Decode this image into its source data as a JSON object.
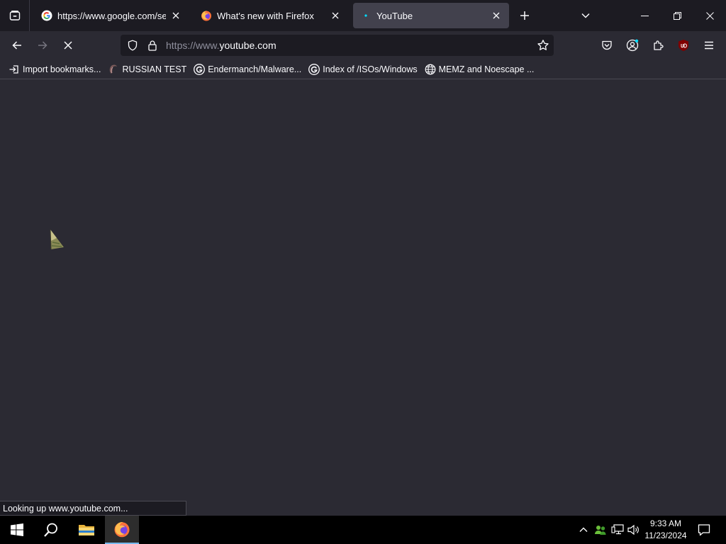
{
  "tabs": [
    {
      "title": "https://www.google.com/search?q=",
      "icon": "google-g-icon",
      "active": false
    },
    {
      "title": "What's new with Firefox",
      "icon": "firefox-icon",
      "active": false
    },
    {
      "title": "YouTube",
      "icon": "loading-dot-icon",
      "active": true
    }
  ],
  "urlbar": {
    "prefix": "https://www.",
    "domain": "youtube.com"
  },
  "bookmarks": [
    {
      "label": "Import bookmarks...",
      "icon": "import-icon"
    },
    {
      "label": "RUSSIAN TEST",
      "icon": "cursor-icon"
    },
    {
      "label": "Endermanch/Malware...",
      "icon": "google-g-icon"
    },
    {
      "label": "Index of /ISOs/Windows",
      "icon": "google-g-icon"
    },
    {
      "label": "MEMZ and Noescape ...",
      "icon": "globe-icon"
    }
  ],
  "status_text": "Looking up www.youtube.com...",
  "clock": {
    "time": "9:33 AM",
    "date": "11/23/2024"
  },
  "colors": {
    "toolbar": "#2b2a33",
    "tabstrip": "#1c1b22",
    "active_tab": "#42414d",
    "accent": "#00ddff",
    "ublock": "#800000"
  }
}
